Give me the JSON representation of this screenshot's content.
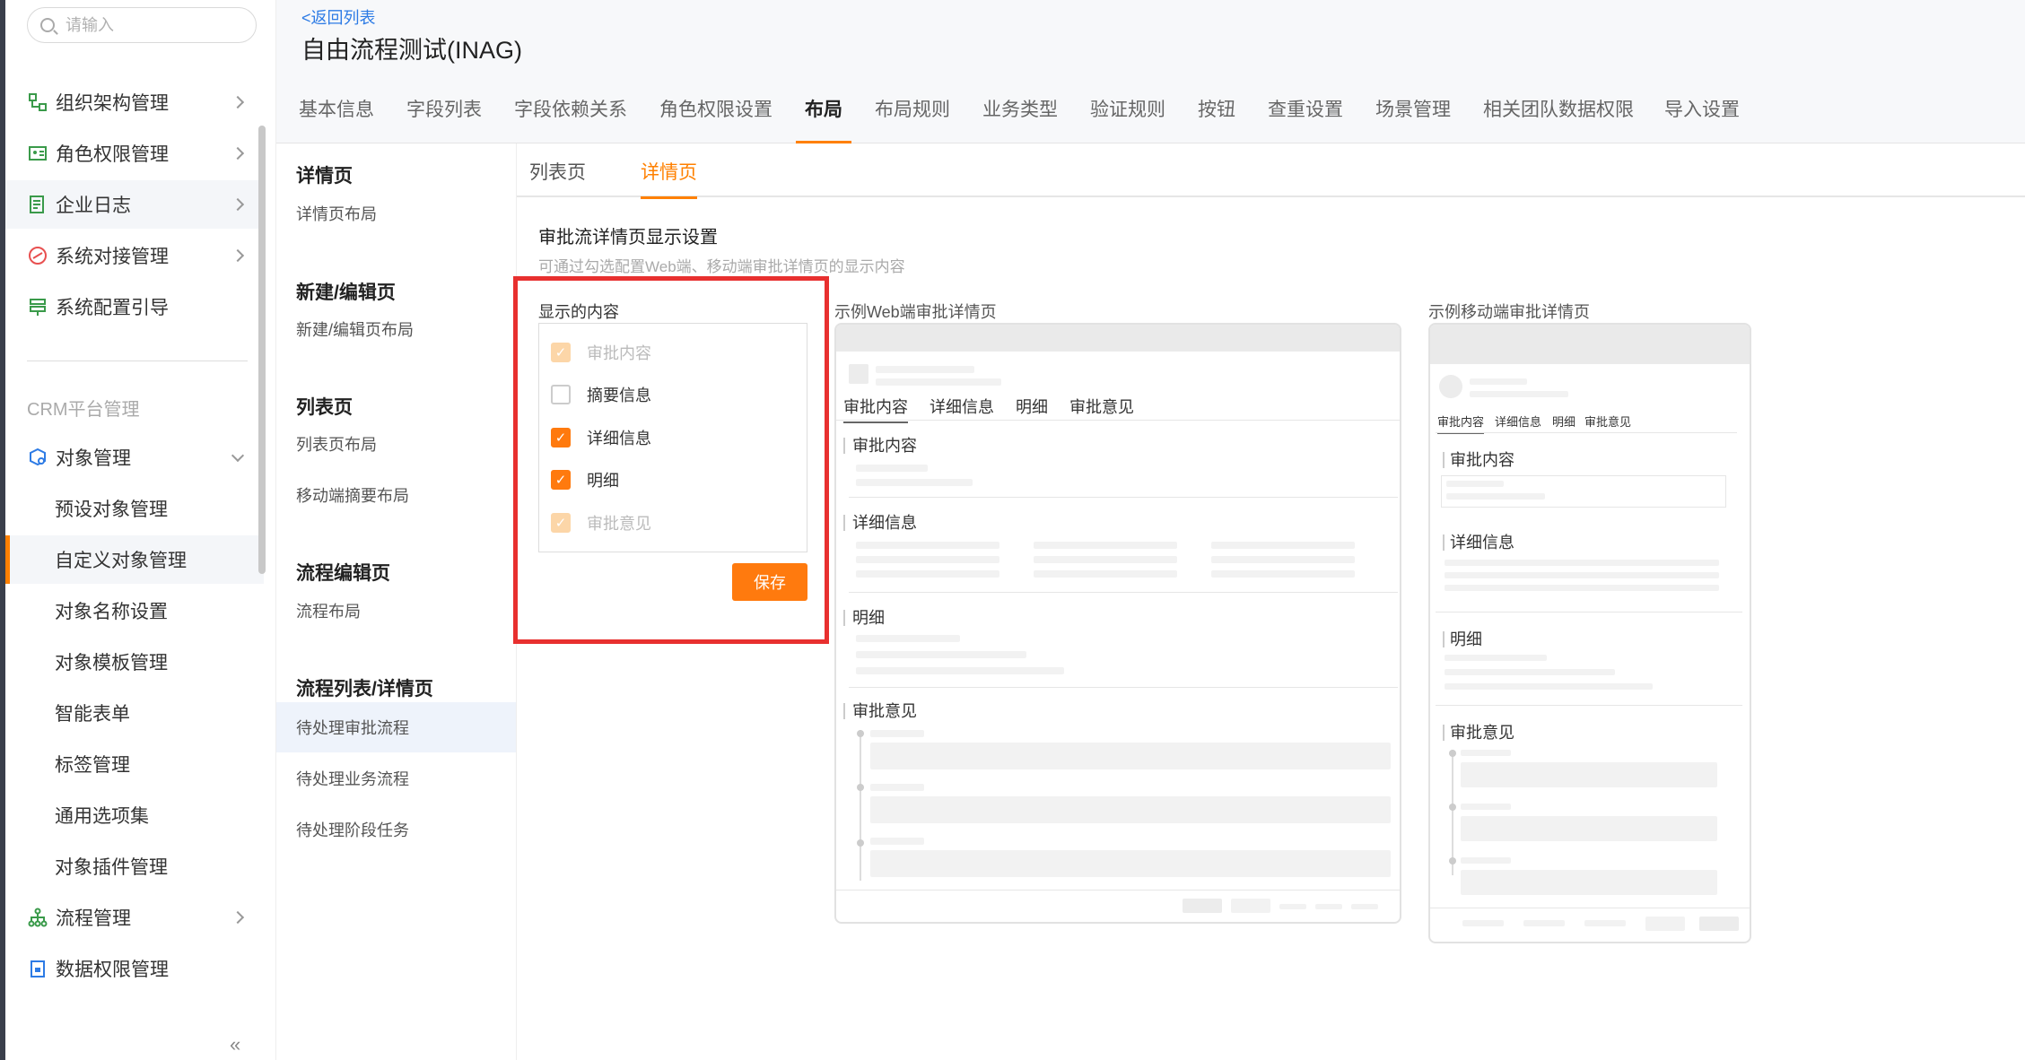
{
  "search": {
    "placeholder": "请输入"
  },
  "sidebar": {
    "items": [
      {
        "label": "组织架构管理"
      },
      {
        "label": "角色权限管理"
      },
      {
        "label": "企业日志"
      },
      {
        "label": "系统对接管理"
      },
      {
        "label": "系统配置引导"
      }
    ],
    "group_label": "CRM平台管理",
    "object_mgmt": {
      "label": "对象管理"
    },
    "sub_items": [
      {
        "label": "预设对象管理"
      },
      {
        "label": "自定义对象管理"
      },
      {
        "label": "对象名称设置"
      },
      {
        "label": "对象模板管理"
      },
      {
        "label": "智能表单"
      },
      {
        "label": "标签管理"
      },
      {
        "label": "通用选项集"
      },
      {
        "label": "对象插件管理"
      }
    ],
    "bottom_items": [
      {
        "label": "流程管理"
      },
      {
        "label": "数据权限管理"
      }
    ],
    "collapse": "«"
  },
  "header": {
    "back": "<返回列表",
    "title": "自由流程测试(INAG)"
  },
  "main_tabs": [
    {
      "label": "基本信息"
    },
    {
      "label": "字段列表"
    },
    {
      "label": "字段依赖关系"
    },
    {
      "label": "角色权限设置"
    },
    {
      "label": "布局"
    },
    {
      "label": "布局规则"
    },
    {
      "label": "业务类型"
    },
    {
      "label": "验证规则"
    },
    {
      "label": "按钮"
    },
    {
      "label": "查重设置"
    },
    {
      "label": "场景管理"
    },
    {
      "label": "相关团队数据权限"
    },
    {
      "label": "导入设置"
    }
  ],
  "sections": [
    {
      "title": "详情页",
      "items": [
        "详情页布局"
      ]
    },
    {
      "title": "新建/编辑页",
      "items": [
        "新建/编辑页布局"
      ]
    },
    {
      "title": "列表页",
      "items": [
        "列表页布局",
        "移动端摘要布局"
      ]
    },
    {
      "title": "流程编辑页",
      "items": [
        "流程布局"
      ]
    },
    {
      "title": "流程列表/详情页",
      "items": [
        "待处理审批流程",
        "待处理业务流程",
        "待处理阶段任务"
      ]
    }
  ],
  "sub_tabs": [
    {
      "label": "列表页"
    },
    {
      "label": "详情页"
    }
  ],
  "config": {
    "title": "审批流详情页显示设置",
    "desc": "可通过勾选配置Web端、移动端审批详情页的显示内容",
    "options_label": "显示的内容",
    "options": [
      {
        "label": "审批内容",
        "checked": true,
        "disabled": true
      },
      {
        "label": "摘要信息",
        "checked": false,
        "disabled": false
      },
      {
        "label": "详细信息",
        "checked": true,
        "disabled": false
      },
      {
        "label": "明细",
        "checked": true,
        "disabled": false
      },
      {
        "label": "审批意见",
        "checked": true,
        "disabled": true
      }
    ],
    "save": "保存",
    "accent": "#ff7a0e",
    "highlight": "#e8302f"
  },
  "web_preview": {
    "label": "示例Web端审批详情页",
    "tabs": [
      "审批内容",
      "详细信息",
      "明细",
      "审批意见"
    ],
    "sections": [
      "审批内容",
      "详细信息",
      "明细",
      "审批意见"
    ]
  },
  "mobile_preview": {
    "label": "示例移动端审批详情页",
    "tabs": [
      "审批内容",
      "详细信息",
      "明细",
      "审批意见"
    ],
    "sections": [
      "审批内容",
      "详细信息",
      "明细",
      "审批意见"
    ]
  }
}
